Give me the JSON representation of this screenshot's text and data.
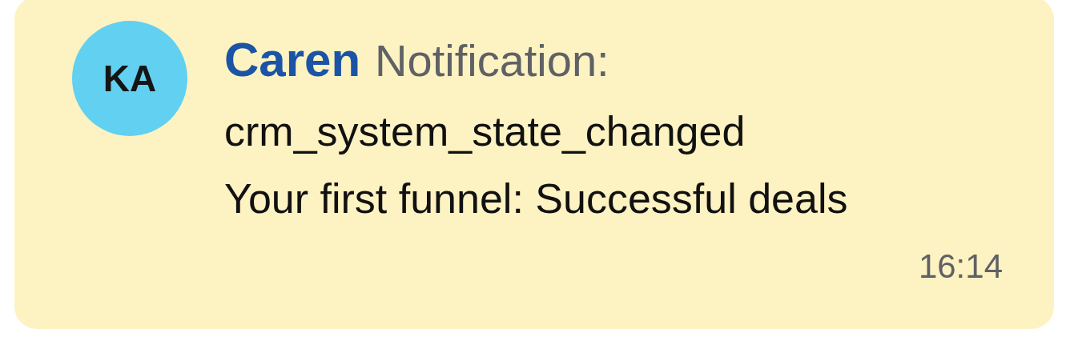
{
  "notification": {
    "avatar": {
      "initials": "KA",
      "color": "#62d0f0"
    },
    "sender": "Caren",
    "title": "Notification:",
    "lines": [
      "crm_system_state_changed",
      "Your first funnel: Successful deals"
    ],
    "time": "16:14"
  }
}
